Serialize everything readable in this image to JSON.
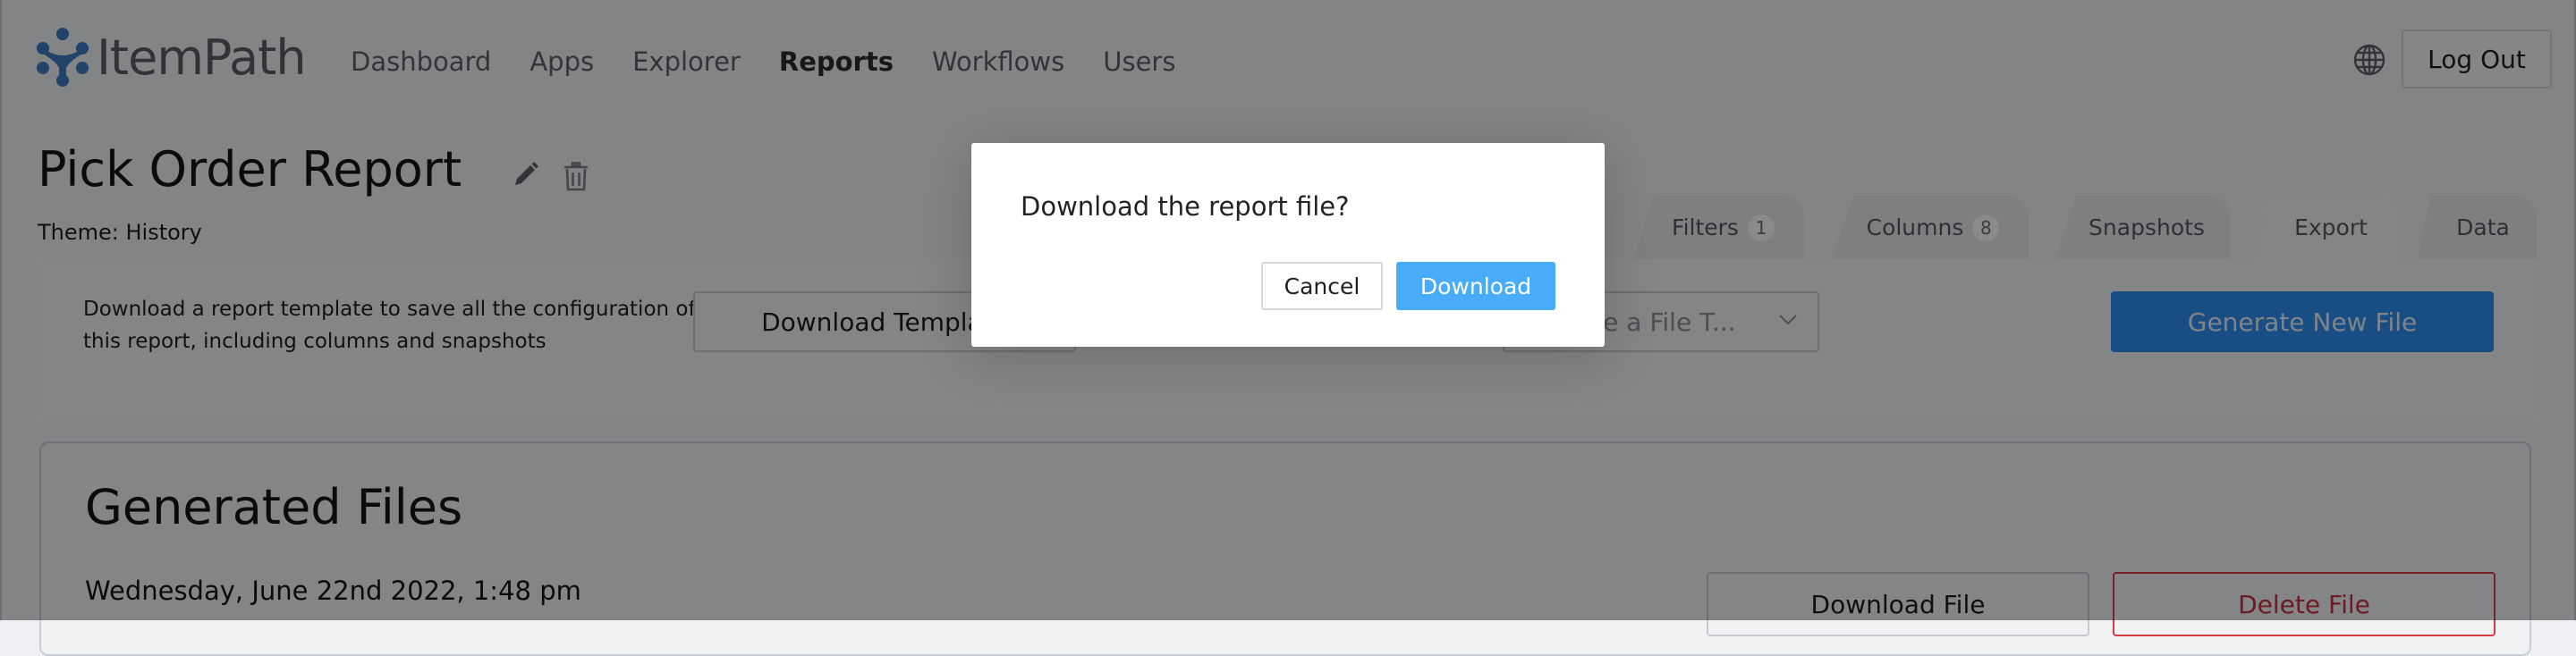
{
  "app": {
    "name": "ItemPath",
    "brand_color": "#3f7bc1"
  },
  "nav": {
    "items": [
      {
        "label": "Dashboard",
        "active": false
      },
      {
        "label": "Apps",
        "active": false
      },
      {
        "label": "Explorer",
        "active": false
      },
      {
        "label": "Reports",
        "active": true
      },
      {
        "label": "Workflows",
        "active": false
      },
      {
        "label": "Users",
        "active": false
      }
    ],
    "language_icon": "globe-icon",
    "logout_label": "Log Out"
  },
  "report": {
    "title": "Pick Order Report",
    "theme": "Theme: History",
    "edit_icon": "pencil-icon",
    "delete_icon": "trash-icon"
  },
  "tabs": [
    {
      "label": "Filters",
      "badge": "1",
      "active": false
    },
    {
      "label": "Columns",
      "badge": "8",
      "active": false
    },
    {
      "label": "Snapshots",
      "badge": null,
      "active": false
    },
    {
      "label": "Export",
      "badge": null,
      "active": true
    },
    {
      "label": "Data",
      "badge": null,
      "active": false
    }
  ],
  "export_panel": {
    "description": "Download a report template to save all the configuration of this report, including columns and snapshots",
    "download_template_label": "Download Template",
    "file_type_placeholder": "Choose a File T...",
    "generate_label": "Generate New File",
    "generate_color": "#2f8ff0"
  },
  "generated_files": {
    "heading": "Generated Files",
    "files": [
      {
        "date": "Wednesday, June 22nd 2022, 1:48 pm",
        "download_label": "Download File",
        "delete_label": "Delete File"
      }
    ]
  },
  "modal": {
    "message": "Download the report file?",
    "cancel_label": "Cancel",
    "confirm_label": "Download",
    "confirm_color": "#48acfb"
  }
}
